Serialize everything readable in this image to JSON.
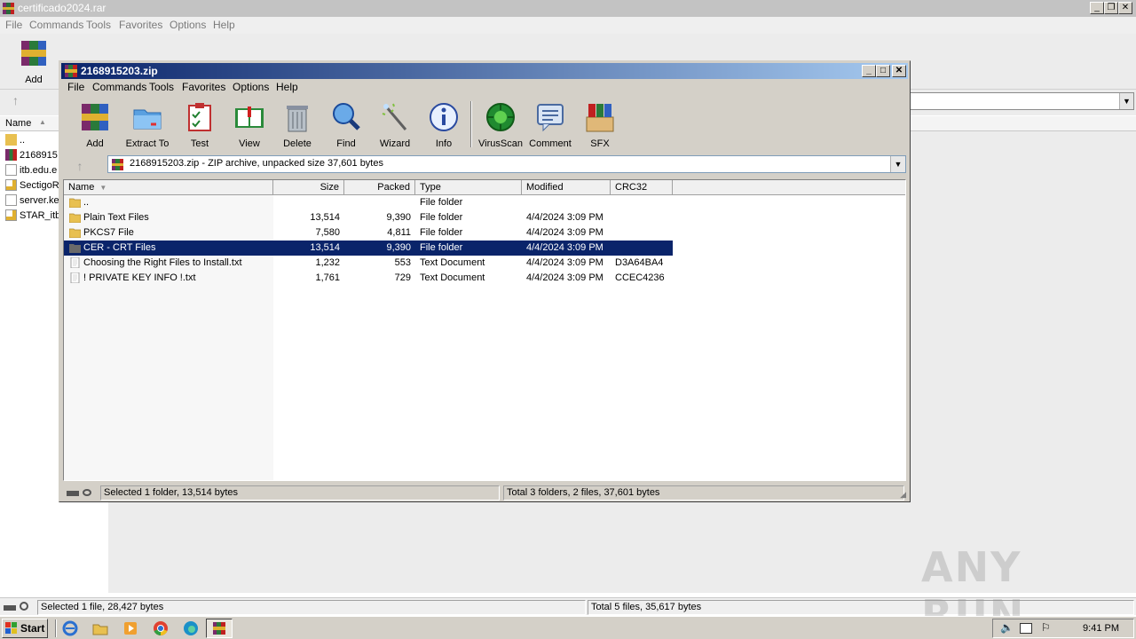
{
  "background_window": {
    "title": "certificado2024.rar",
    "menu": [
      "File",
      "Commands",
      "Tools",
      "Favorites",
      "Options",
      "Help"
    ],
    "toolbar_first_label": "Add",
    "header_name": "Name",
    "files": [
      "..",
      "2168915",
      "itb.edu.e",
      "SectigoR",
      "server.ke",
      "STAR_itb"
    ],
    "status_left": "Selected 1 file, 28,427 bytes",
    "status_right": "Total 5 files, 35,617 bytes"
  },
  "window": {
    "title": "2168915203.zip",
    "menu": [
      "File",
      "Commands",
      "Tools",
      "Favorites",
      "Options",
      "Help"
    ],
    "toolbar": [
      {
        "label": "Add",
        "icon": "add-archive-icon"
      },
      {
        "label": "Extract To",
        "icon": "extract-folder-icon"
      },
      {
        "label": "Test",
        "icon": "test-clipboard-icon"
      },
      {
        "label": "View",
        "icon": "view-book-icon"
      },
      {
        "label": "Delete",
        "icon": "trash-icon"
      },
      {
        "label": "Find",
        "icon": "magnifier-icon"
      },
      {
        "label": "Wizard",
        "icon": "wand-icon"
      },
      {
        "label": "Info",
        "icon": "info-icon"
      },
      {
        "label": "VirusScan",
        "icon": "virus-icon"
      },
      {
        "label": "Comment",
        "icon": "comment-icon"
      },
      {
        "label": "SFX",
        "icon": "sfx-box-icon"
      }
    ],
    "address": "2168915203.zip - ZIP archive, unpacked size 37,601 bytes",
    "columns": [
      "Name",
      "Size",
      "Packed",
      "Type",
      "Modified",
      "CRC32"
    ],
    "rows": [
      {
        "name": "..",
        "size": "",
        "packed": "",
        "type": "File folder",
        "modified": "",
        "crc": "",
        "kind": "folder"
      },
      {
        "name": "Plain Text Files",
        "size": "13,514",
        "packed": "9,390",
        "type": "File folder",
        "modified": "4/4/2024 3:09 PM",
        "crc": "",
        "kind": "folder"
      },
      {
        "name": "PKCS7 File",
        "size": "7,580",
        "packed": "4,811",
        "type": "File folder",
        "modified": "4/4/2024 3:09 PM",
        "crc": "",
        "kind": "folder"
      },
      {
        "name": "CER - CRT Files",
        "size": "13,514",
        "packed": "9,390",
        "type": "File folder",
        "modified": "4/4/2024 3:09 PM",
        "crc": "",
        "kind": "folder",
        "selected": true
      },
      {
        "name": "Choosing the Right Files to Install.txt",
        "size": "1,232",
        "packed": "553",
        "type": "Text Document",
        "modified": "4/4/2024 3:09 PM",
        "crc": "D3A64BA4",
        "kind": "text"
      },
      {
        "name": "! PRIVATE KEY INFO !.txt",
        "size": "1,761",
        "packed": "729",
        "type": "Text Document",
        "modified": "4/4/2024 3:09 PM",
        "crc": "CCEC4236",
        "kind": "text"
      }
    ],
    "status_left": "Selected 1 folder, 13,514 bytes",
    "status_right": "Total 3 folders, 2 files, 37,601 bytes"
  },
  "taskbar": {
    "start": "Start",
    "clock": "9:41 PM"
  },
  "watermark": "ANY RUN",
  "colors": {
    "selection": "#0a246a",
    "title_gradient_start": "#0a246a",
    "title_gradient_end": "#a6caf0"
  }
}
